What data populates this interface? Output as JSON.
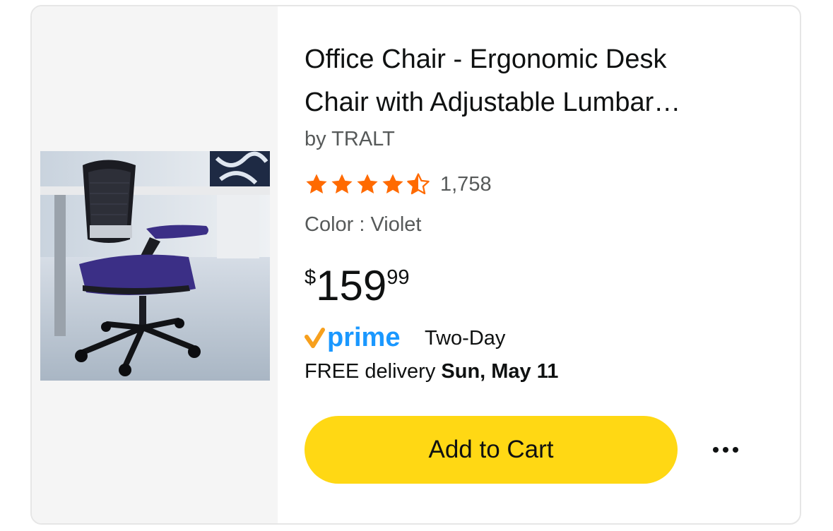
{
  "product": {
    "title_line1": "Office Chair - Ergonomic Desk",
    "title_line2": "Chair with Adjustable Lumbar…",
    "byline": "by TRALT",
    "rating": 4.5,
    "rating_count": "1,758",
    "color": "Color : Violet",
    "price": {
      "currency": "$",
      "whole": "159",
      "fraction": "99"
    },
    "prime": {
      "logo_text": "prime",
      "label": "Two-Day"
    },
    "delivery": {
      "prefix": "FREE delivery",
      "date": "Sun, May 11"
    }
  },
  "actions": {
    "add_to_cart": "Add to Cart",
    "more_icon": "ellipsis-icon"
  },
  "icons": {
    "stars": [
      "star-full-icon",
      "star-full-icon",
      "star-full-icon",
      "star-full-icon",
      "star-half-icon"
    ],
    "prime_check": "prime-check-icon"
  },
  "colors": {
    "star": "#ff6a00",
    "prime_blue": "#1a98ff",
    "prime_check": "#f7a01d",
    "button": "#ffd814",
    "text_primary": "#0f1111",
    "text_secondary": "#565959",
    "image_panel_bg": "#f5f5f5"
  }
}
